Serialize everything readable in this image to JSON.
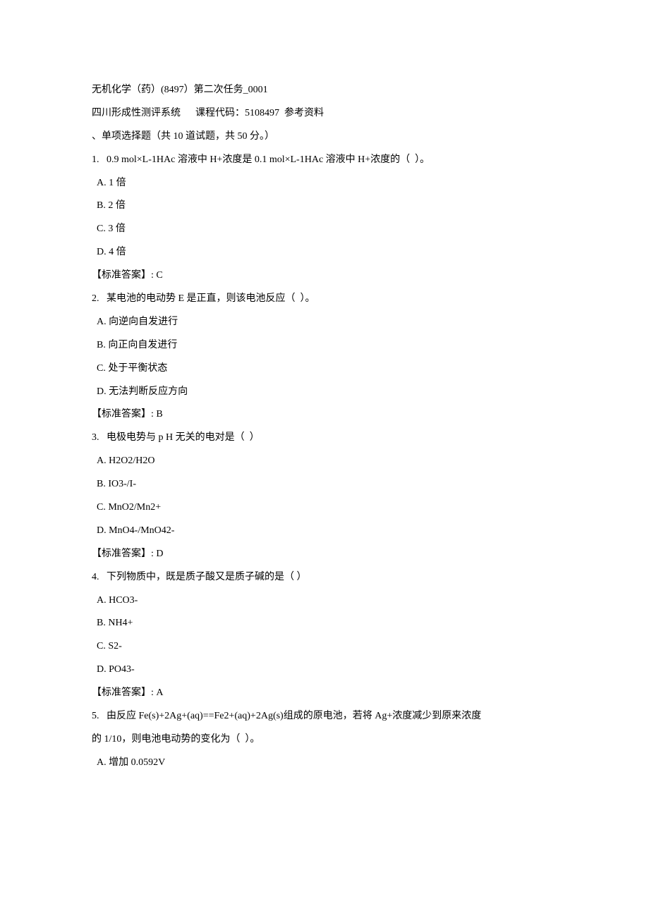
{
  "doc": {
    "title": "无机化学（药）(8497）第二次任务_0001",
    "subtitle": "四川形成性测评系统      课程代码：5108497  参考资料",
    "section_header": "、单项选择题（共 10 道试题，共 50 分。）",
    "questions": [
      {
        "num": "1.",
        "stem": "0.9 mol×L-1HAc 溶液中 H+浓度是 0.1 mol×L-1HAc 溶液中 H+浓度的（  ）。",
        "options": {
          "A": "A. 1 倍",
          "B": "B. 2 倍",
          "C": "C. 3 倍",
          "D": "D. 4 倍"
        },
        "answer_label": "【标准答案】:",
        "answer": "C"
      },
      {
        "num": "2.",
        "stem": "某电池的电动势 E 是正直，则该电池反应（  ）。",
        "options": {
          "A": "A. 向逆向自发进行",
          "B": "B. 向正向自发进行",
          "C": "C. 处于平衡状态",
          "D": "D. 无法判断反应方向"
        },
        "answer_label": "【标准答案】:",
        "answer": "B"
      },
      {
        "num": "3.",
        "stem": "电极电势与 p H 无关的电对是（  ）",
        "options": {
          "A": "A. H2O2/H2O",
          "B": "B. IO3-/I-",
          "C": "C. MnO2/Mn2+",
          "D": "D. MnO4-/MnO42-"
        },
        "answer_label": "【标准答案】:",
        "answer": "D"
      },
      {
        "num": "4.",
        "stem": "下列物质中，既是质子酸又是质子碱的是（ ）",
        "options": {
          "A": "A. HCO3-",
          "B": "B. NH4+",
          "C": "C. S2-",
          "D": "D. PO43-"
        },
        "answer_label": "【标准答案】:",
        "answer": "A"
      },
      {
        "num": "5.",
        "stem_line1": "由反应 Fe(s)+2Ag+(aq)==Fe2+(aq)+2Ag(s)组成的原电池，若将 Ag+浓度减少到原来浓度",
        "stem_line2": "的 1/10，则电池电动势的变化为（  ）。",
        "options": {
          "A": "A. 增加 0.0592V"
        }
      }
    ]
  }
}
